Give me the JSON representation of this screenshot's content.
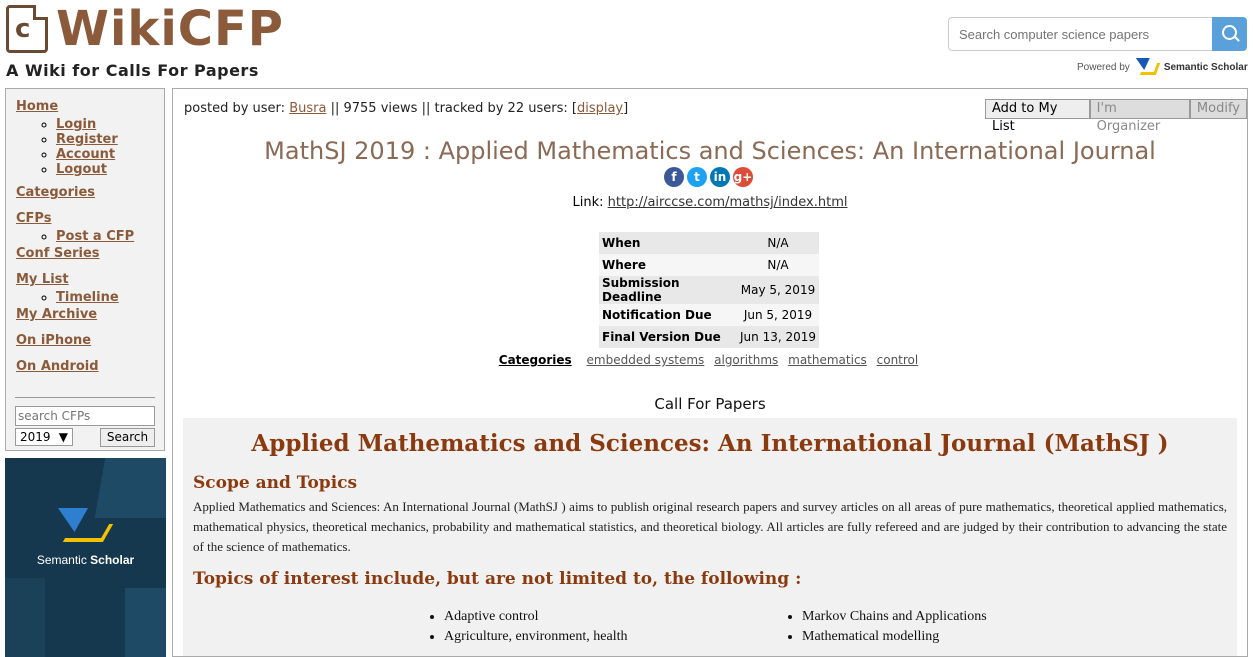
{
  "header": {
    "logo_letter": "c",
    "logo_text": "WikiCFP",
    "tagline": "A Wiki for Calls For Papers",
    "search_placeholder": "Search computer science papers",
    "powered_by": "Powered by",
    "powered_brand": "Semantic Scholar"
  },
  "sidebar": {
    "home": "Home",
    "login": "Login",
    "register": "Register",
    "account": "Account",
    "logout": "Logout",
    "categories": "Categories",
    "cfps": "CFPs",
    "post_cfp": "Post a CFP",
    "conf_series": "Conf Series",
    "my_list": "My List",
    "timeline": "Timeline",
    "my_archive": "My Archive",
    "on_iphone": "On iPhone",
    "on_android": "On Android",
    "search_placeholder": "search CFPs",
    "year": "2019",
    "search_button": "Search"
  },
  "ad": {
    "brand_light": "Semantic ",
    "brand_bold": "Scholar"
  },
  "main": {
    "posted_by_label": "posted by user:",
    "posted_by_user": "Busra",
    "views": "9755 views",
    "tracked": "tracked by 22 users:",
    "display_link": "display",
    "sep": "||",
    "add_to_list": "Add to My List",
    "organizer": "I'm Organizer",
    "modify": "Modify",
    "title": "MathSJ 2019 : Applied Mathematics and Sciences: An International Journal",
    "share": {
      "facebook": "f",
      "twitter": "t",
      "linkedin": "in",
      "google": "g+"
    },
    "link_label": "Link:",
    "link_url": "http://airccse.com/mathsj/index.html",
    "info": [
      {
        "k": "When",
        "v": "N/A"
      },
      {
        "k": "Where",
        "v": "N/A"
      },
      {
        "k": "Submission Deadline",
        "v": "May 5, 2019"
      },
      {
        "k": "Notification Due",
        "v": "Jun 5, 2019"
      },
      {
        "k": "Final Version Due",
        "v": "Jun 13, 2019"
      }
    ],
    "categories_label": "Categories",
    "categories": [
      "embedded systems",
      "algorithms",
      "mathematics",
      "control"
    ],
    "cfp_heading": "Call For Papers",
    "journal_title": "Applied Mathematics and Sciences: An International Journal (MathSJ )",
    "scope_heading": "Scope and Topics",
    "scope_text": "Applied Mathematics and Sciences: An International Journal (MathSJ ) aims to publish original research papers and survey articles on all areas of pure mathematics, theoretical applied mathematics, mathematical physics, theoretical mechanics, probability and mathematical statistics, and theoretical biology. All articles are fully refereed and are judged by their contribution to advancing the state of the science of mathematics.",
    "topics_heading": "Topics of interest include, but are not limited to, the following :",
    "topics_left": [
      "Adaptive control",
      "Agriculture, environment, health"
    ],
    "topics_right": [
      "Markov Chains and Applications",
      "Mathematical modelling"
    ]
  },
  "colors": {
    "brand_brown": "#8a5a3a",
    "accent_red": "#8b3a0f",
    "search_blue": "#5aa1dc",
    "ad_bg": "#16384f"
  }
}
